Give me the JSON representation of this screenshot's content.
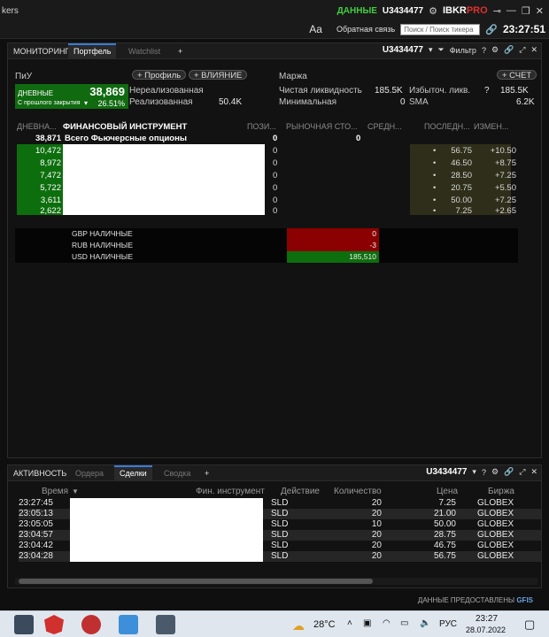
{
  "titlebar": {
    "app_fragment": "kers",
    "data_label": "ДАННЫЕ",
    "account": "U3434477",
    "brand_main": "IBKR",
    "brand_accent": "PRO"
  },
  "toolbar": {
    "font_btn": "Aa",
    "feedback": "Обратная связь",
    "search_placeholder": "Поиск / Поиск тикера",
    "clock": "23:27:51"
  },
  "top_panel": {
    "tabs": [
      "МОНИТОРИНГ",
      "Портфель",
      "Watchlist",
      "+"
    ],
    "account": "U3434477",
    "filter": "Фильтр",
    "help": "?",
    "pnl": {
      "title": "ПиУ",
      "profile_btn": "+ Профиль",
      "influence_btn": "+ ВЛИЯНИЕ",
      "daily_label": "ДНЕВНЫЕ",
      "daily_value": "38,869",
      "since_close_label": "С прошлого закрытия",
      "since_close_pct": "26.51%",
      "unrealized_label": "Нереализованная",
      "realized_label": "Реализованная",
      "realized_value": "50.4K"
    },
    "margin": {
      "title": "Маржа",
      "account_btn": "+ СЧЕТ",
      "net_liq_label": "Чистая ликвидность",
      "net_liq_value": "185.5K",
      "excess_liq_label": "Избыточ. ликв.",
      "excess_help": "?",
      "excess_value": "185.5K",
      "minimal_label": "Минимальная",
      "minimal_value": "0",
      "sma_label": "SMA",
      "sma_value": "6.2K"
    },
    "columns": [
      "ДНЕВНА...",
      "ФИНАНСОВЫЙ ИНСТРУМЕНТ",
      "ПОЗИ...",
      "РЫНОЧНАЯ СТО...",
      "СРЕДН...",
      "ПОСЛЕДН...",
      "ИЗМЕН..."
    ],
    "total_row": {
      "daily": "38,871",
      "instrument": "Всего Фьючерсные опционы",
      "position": "0",
      "market_value": "0"
    },
    "rows": [
      {
        "daily": "10,472",
        "position": "0",
        "last": "56.75",
        "change": "+10.50"
      },
      {
        "daily": "8,972",
        "position": "0",
        "last": "46.50",
        "change": "+8.75"
      },
      {
        "daily": "7,472",
        "position": "0",
        "last": "28.50",
        "change": "+7.25"
      },
      {
        "daily": "5,722",
        "position": "0",
        "last": "20.75",
        "change": "+5.50"
      },
      {
        "daily": "3,611",
        "position": "0",
        "last": "50.00",
        "change": "+7.25"
      },
      {
        "daily": "2,622",
        "position": "0",
        "last": "7.25",
        "change": "+2.65"
      }
    ],
    "cash": [
      {
        "name": "GBP НАЛИЧНЫЕ",
        "value": "0",
        "color": "#8b0000"
      },
      {
        "name": "RUB НАЛИЧНЫЕ",
        "value": "-3",
        "color": "#8b0000"
      },
      {
        "name": "USD НАЛИЧНЫЕ",
        "value": "185,510",
        "color": "#0d6e0d"
      }
    ]
  },
  "bottom_panel": {
    "tabs": [
      "АКТИВНОСТЬ",
      "Ордера",
      "Сделки",
      "Сводка",
      "+"
    ],
    "account": "U3434477",
    "help": "?",
    "columns": [
      "Время",
      "Фин. инструмент",
      "Действие",
      "Количество",
      "Цена",
      "Биржа"
    ],
    "trades": [
      {
        "time": "23:27:45",
        "action": "SLD",
        "qty": "20",
        "price": "7.25",
        "exchange": "GLOBEX"
      },
      {
        "time": "23:05:13",
        "action": "SLD",
        "qty": "20",
        "price": "21.00",
        "exchange": "GLOBEX"
      },
      {
        "time": "23:05:05",
        "action": "SLD",
        "qty": "10",
        "price": "50.00",
        "exchange": "GLOBEX"
      },
      {
        "time": "23:04:57",
        "action": "SLD",
        "qty": "20",
        "price": "28.75",
        "exchange": "GLOBEX"
      },
      {
        "time": "23:04:42",
        "action": "SLD",
        "qty": "20",
        "price": "46.75",
        "exchange": "GLOBEX"
      },
      {
        "time": "23:04:28",
        "action": "SLD",
        "qty": "20",
        "price": "56.75",
        "exchange": "GLOBEX"
      }
    ]
  },
  "footer": {
    "provided": "ДАННЫЕ ПРЕДОСТАВЛЕНЫ",
    "provider": "GFIS"
  },
  "taskbar": {
    "temperature": "28°C",
    "lang": "РУС",
    "time": "23:27",
    "date": "28.07.2022"
  }
}
